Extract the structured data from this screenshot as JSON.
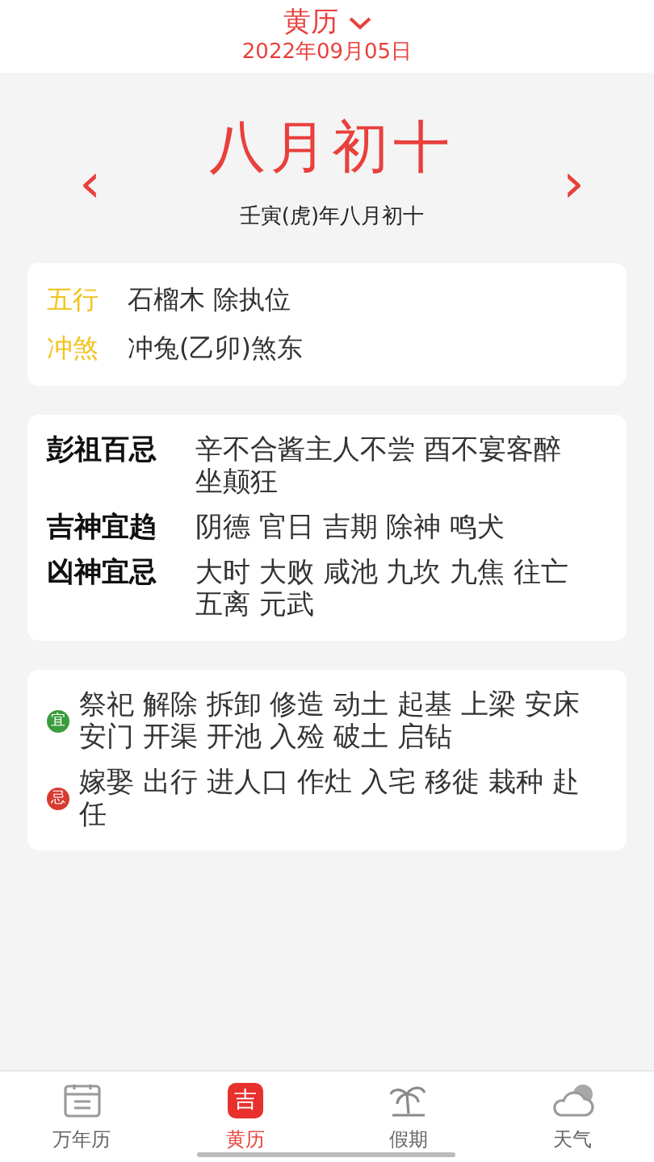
{
  "header": {
    "title": "黄历",
    "date": "2022年09月05日"
  },
  "lunar": {
    "prev": "‹",
    "day": "八月初十",
    "next": "›",
    "year_line": "壬寅(虎)年八月初十"
  },
  "elements": [
    {
      "label": "五行",
      "value": "石榴木 除执位"
    },
    {
      "label": "冲煞",
      "value": "冲兔(乙卯)煞东"
    }
  ],
  "details": [
    {
      "label": "彭祖百忌",
      "value": "辛不合酱主人不尝 酉不宴客醉坐颠狂"
    },
    {
      "label": "吉神宜趋",
      "value": "阴德 官日 吉期 除神 鸣犬"
    },
    {
      "label": "凶神宜忌",
      "value": "大时 大败 咸池 九坎 九焦 往亡五离 元武"
    }
  ],
  "activities": [
    {
      "kind": "good",
      "badge": "宜",
      "value": "祭祀 解除 拆卸 修造 动土 起基 上梁 安床安门 开渠 开池 入殓 破土 启钻"
    },
    {
      "kind": "bad",
      "badge": "忌",
      "value": "嫁娶 出行 进人口 作灶 入宅 移徙 栽种 赴任"
    }
  ],
  "tabs": [
    {
      "kind": "calendar",
      "label": "万年历",
      "selected": false
    },
    {
      "kind": "glyph",
      "glyph": "吉",
      "label": "黄历",
      "selected": true
    },
    {
      "kind": "palm",
      "label": "假期",
      "selected": false
    },
    {
      "kind": "cloud",
      "label": "天气",
      "selected": false
    }
  ]
}
